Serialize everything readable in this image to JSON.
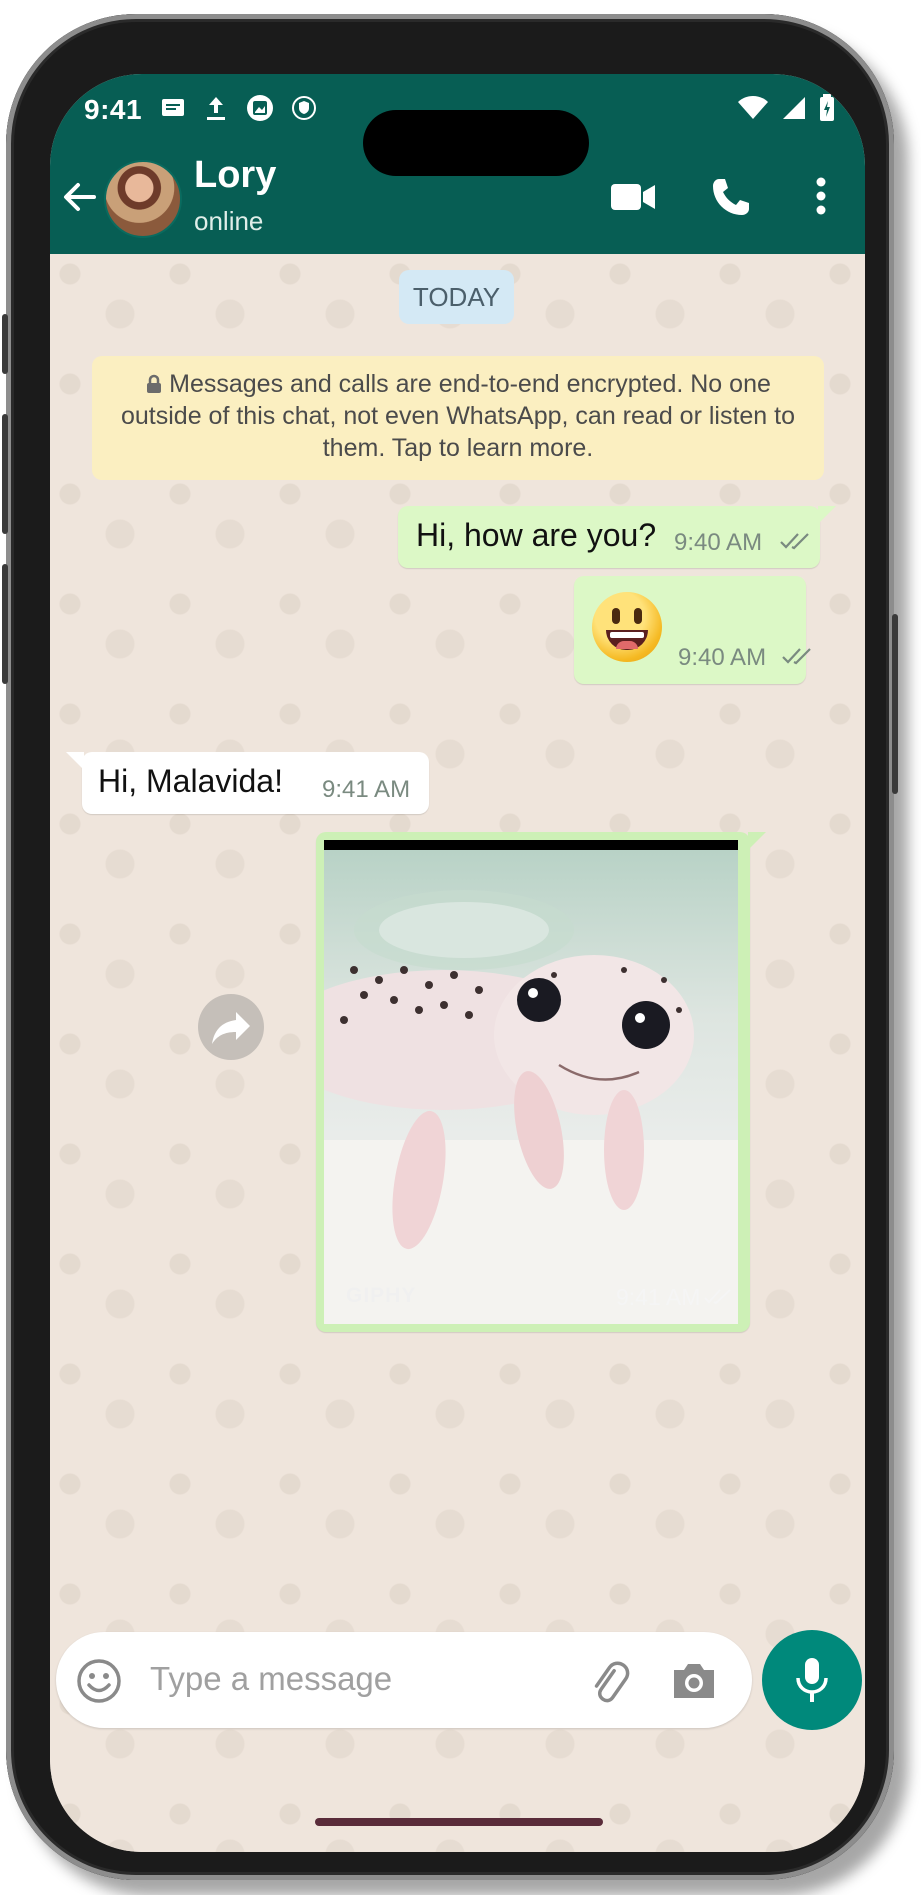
{
  "status_bar": {
    "time": "9:41"
  },
  "header": {
    "contact_name": "Lory",
    "contact_status": "online"
  },
  "chat": {
    "date_chip": "TODAY",
    "encryption_notice": "Messages and calls are end-to-end encrypted. No one outside of this chat, not even WhatsApp, can read or listen to them. Tap to learn more.",
    "messages": [
      {
        "direction": "out",
        "text": "Hi, how are you?",
        "time": "9:40 AM"
      },
      {
        "direction": "out",
        "emoji": "grinning-face",
        "time": "9:40 AM"
      },
      {
        "direction": "in",
        "text": "Hi, Malavida!",
        "time": "9:41 AM"
      },
      {
        "direction": "out",
        "media": "gif",
        "media_label": "GIPHY",
        "time": "9:41 AM"
      }
    ]
  },
  "composer": {
    "placeholder": "Type a message"
  },
  "colors": {
    "header_green": "#075e54",
    "outgoing_bubble": "#dcf8c6",
    "incoming_bubble": "#ffffff",
    "encryption_notice": "#fbefc1",
    "date_chip": "#d4e9f5",
    "mic_button": "#00897b",
    "read_ticks": "#7a8a80"
  }
}
